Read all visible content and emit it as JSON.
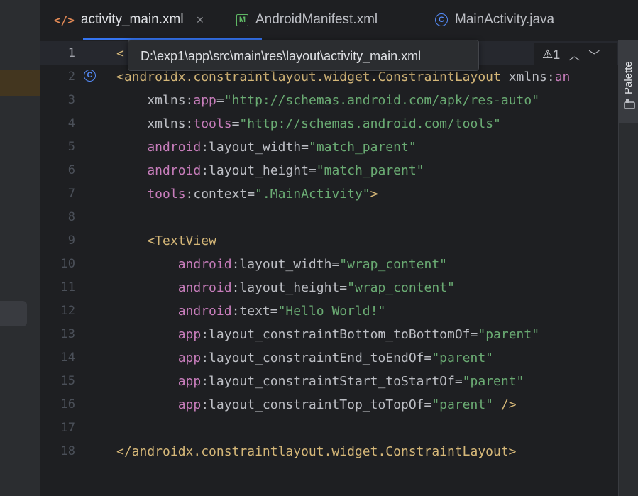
{
  "tabs": [
    {
      "label": "activity_main.xml",
      "icon": "xml-file-icon",
      "active": true,
      "close": "×"
    },
    {
      "label": "AndroidManifest.xml",
      "icon": "manifest-file-icon",
      "active": false
    },
    {
      "label": "MainActivity.java",
      "icon": "java-class-icon",
      "active": false
    }
  ],
  "tooltip": {
    "path": "D:\\exp1\\app\\src\\main\\res\\layout\\activity_main.xml"
  },
  "warnings": {
    "count": "1",
    "icon": "warning-icon"
  },
  "side_panel": {
    "palette_label": "Palette"
  },
  "editor": {
    "line_numbers": [
      "1",
      "2",
      "3",
      "4",
      "5",
      "6",
      "7",
      "8",
      "9",
      "10",
      "11",
      "12",
      "13",
      "14",
      "15",
      "16",
      "17",
      "18"
    ],
    "lines": [
      [
        {
          "t": "<",
          "c": "tag"
        }
      ],
      [
        {
          "t": "<androidx.constraintlayout.widget.ConstraintLayout ",
          "c": "tag"
        },
        {
          "t": "xmlns:",
          "c": "attr"
        },
        {
          "t": "an",
          "c": "ns"
        }
      ],
      [
        {
          "t": "    xmlns:",
          "c": "attr"
        },
        {
          "t": "app",
          "c": "ns"
        },
        {
          "t": "=",
          "c": "attr"
        },
        {
          "t": "\"http://schemas.android.com/apk/res-auto\"",
          "c": "val"
        }
      ],
      [
        {
          "t": "    xmlns:",
          "c": "attr"
        },
        {
          "t": "tools",
          "c": "ns"
        },
        {
          "t": "=",
          "c": "attr"
        },
        {
          "t": "\"http://schemas.android.com/tools\"",
          "c": "val"
        }
      ],
      [
        {
          "t": "    android",
          "c": "ns"
        },
        {
          "t": ":layout_width=",
          "c": "attr"
        },
        {
          "t": "\"match_parent\"",
          "c": "val"
        }
      ],
      [
        {
          "t": "    android",
          "c": "ns"
        },
        {
          "t": ":layout_height=",
          "c": "attr"
        },
        {
          "t": "\"match_parent\"",
          "c": "val"
        }
      ],
      [
        {
          "t": "    tools",
          "c": "ns"
        },
        {
          "t": ":context=",
          "c": "attr"
        },
        {
          "t": "\".MainActivity\"",
          "c": "val"
        },
        {
          "t": ">",
          "c": "tag"
        }
      ],
      [],
      [
        {
          "t": "    <TextView",
          "c": "tag"
        }
      ],
      [
        {
          "t": "        android",
          "c": "ns"
        },
        {
          "t": ":layout_width=",
          "c": "attr"
        },
        {
          "t": "\"wrap_content\"",
          "c": "val"
        }
      ],
      [
        {
          "t": "        android",
          "c": "ns"
        },
        {
          "t": ":layout_height=",
          "c": "attr"
        },
        {
          "t": "\"wrap_content\"",
          "c": "val"
        }
      ],
      [
        {
          "t": "        android",
          "c": "ns"
        },
        {
          "t": ":text=",
          "c": "attr"
        },
        {
          "t": "\"Hello World!\"",
          "c": "val"
        }
      ],
      [
        {
          "t": "        app",
          "c": "ns"
        },
        {
          "t": ":layout_constraintBottom_toBottomOf=",
          "c": "attr"
        },
        {
          "t": "\"parent\"",
          "c": "val"
        }
      ],
      [
        {
          "t": "        app",
          "c": "ns"
        },
        {
          "t": ":layout_constraintEnd_toEndOf=",
          "c": "attr"
        },
        {
          "t": "\"parent\"",
          "c": "val"
        }
      ],
      [
        {
          "t": "        app",
          "c": "ns"
        },
        {
          "t": ":layout_constraintStart_toStartOf=",
          "c": "attr"
        },
        {
          "t": "\"parent\"",
          "c": "val"
        }
      ],
      [
        {
          "t": "        app",
          "c": "ns"
        },
        {
          "t": ":layout_constraintTop_toTopOf=",
          "c": "attr"
        },
        {
          "t": "\"parent\"",
          "c": "val"
        },
        {
          "t": " />",
          "c": "tag"
        }
      ],
      [],
      [
        {
          "t": "</androidx.constraintlayout.widget.ConstraintLayout>",
          "c": "tag"
        }
      ]
    ]
  },
  "colors": {
    "accent": "#3574f0",
    "tag": "#d5b778",
    "namespace": "#c77dbb",
    "value": "#6aab73"
  }
}
